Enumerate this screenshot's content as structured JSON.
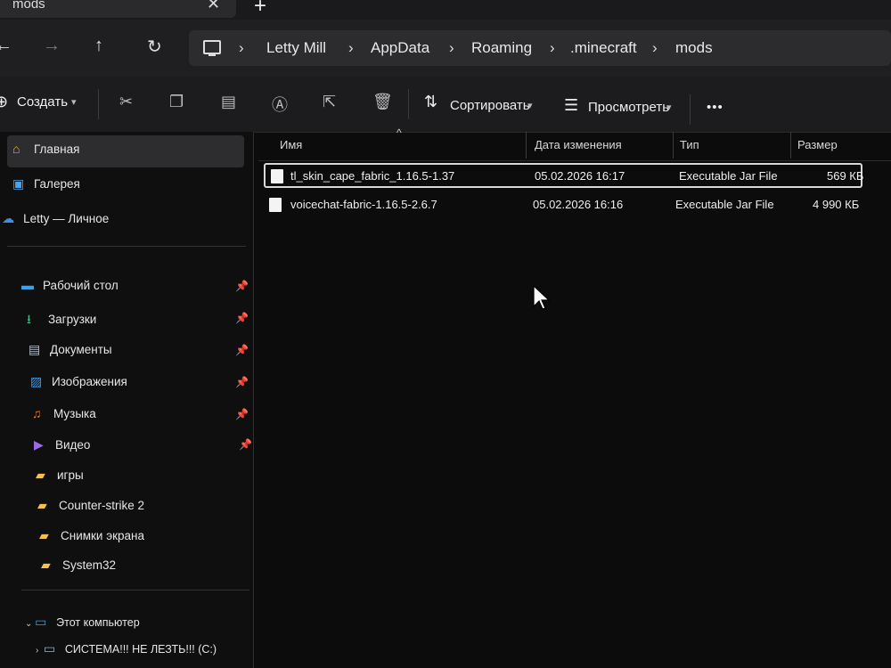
{
  "tab": {
    "title": "mods",
    "close": "✕",
    "new_tab": "+"
  },
  "nav": {
    "back": "←",
    "forward": "→",
    "up": "↑",
    "refresh": "↻"
  },
  "breadcrumbs": [
    "Letty Mill",
    "AppData",
    "Roaming",
    ".minecraft",
    "mods"
  ],
  "breadcrumb_sep": "›",
  "toolbar": {
    "create": "Создать",
    "sort": "Сортировать",
    "view": "Просмотреть",
    "more": "•••"
  },
  "sidebar": {
    "quick": [
      {
        "label": "Главная",
        "icon": "home-icon"
      },
      {
        "label": "Галерея",
        "icon": "gallery-icon"
      },
      {
        "label": "Letty — Личное",
        "icon": "cloud-icon"
      }
    ],
    "pinned": [
      {
        "label": "Рабочий стол",
        "icon": "desktop-icon"
      },
      {
        "label": "Загрузки",
        "icon": "download-icon"
      },
      {
        "label": "Документы",
        "icon": "document-icon"
      },
      {
        "label": "Изображения",
        "icon": "image-icon"
      },
      {
        "label": "Музыка",
        "icon": "music-icon"
      },
      {
        "label": "Видео",
        "icon": "video-icon"
      }
    ],
    "folders": [
      "игры",
      "Counter-strike 2",
      "Снимки экрана",
      "System32"
    ],
    "this_pc": "Этот компьютер",
    "drive": "СИСТЕМА!!! НЕ ЛЕЗТЬ!!! (C:)"
  },
  "columns": {
    "name": "Имя",
    "modified": "Дата изменения",
    "type": "Тип",
    "size": "Размер"
  },
  "files": [
    {
      "name": "tl_skin_cape_fabric_1.16.5-1.37",
      "modified": "05.02.2026 16:17",
      "type": "Executable Jar File",
      "size": "569 КБ"
    },
    {
      "name": "voicechat-fabric-1.16.5-2.6.7",
      "modified": "05.02.2026 16:16",
      "type": "Executable Jar File",
      "size": "4 990 КБ"
    }
  ],
  "colors": {
    "background": "#0c0c0d",
    "folder": "#f2c14e",
    "accent": "#3a8ee6"
  }
}
